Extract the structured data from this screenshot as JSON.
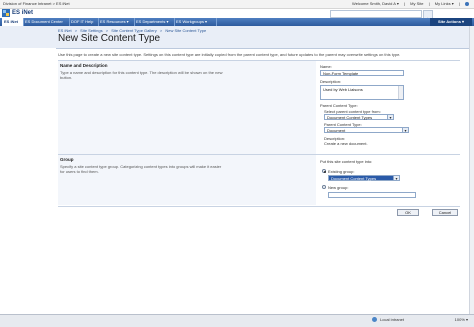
{
  "topbar": {
    "breadcrumb": "Division of Finance Intranet > ES iNet",
    "welcome": "Welcome Smith, David A ▾",
    "mysite": "My Site",
    "mylinks": "My Links ▾",
    "help_icon": "help-icon"
  },
  "site": {
    "title": "ES iNet",
    "logo_icon": "site-logo-icon",
    "search_icon": "search-icon"
  },
  "nav": {
    "tabs": [
      {
        "label": "ES iNet",
        "active": true
      },
      {
        "label": "ES Document Center"
      },
      {
        "label": "DOF IT Help"
      },
      {
        "label": "ES Resources ▾"
      },
      {
        "label": "ES Departments ▾"
      },
      {
        "label": "ES Workgroups ▾"
      }
    ],
    "site_actions": "Site Actions ▾"
  },
  "header": {
    "breadcrumb": [
      "ES iNet",
      "Site Settings",
      "Site Content Type Gallery",
      "New Site Content Type"
    ],
    "separator": ">",
    "page_title": "New Site Content Type"
  },
  "description": "Use this page to create a new site content type. Settings on this content type are initially copied from the parent content type, and future updates to the parent may overwrite settings on this type.",
  "section_name": {
    "heading": "Name and Description",
    "text": "Type a name and description for this content type. The description will be shown on the new button.",
    "name_label": "Name:",
    "name_value": "Non-Form Template",
    "description_label": "Description:",
    "description_value": "Used by Web Liaisons",
    "parent_label": "Parent Content Type:",
    "select_from_label": "Select parent content type from:",
    "select_from_value": "Document Content Types",
    "parent_type_label": "Parent Content Type:",
    "parent_type_value": "Document",
    "desc_label": "Description:",
    "desc_text": "Create a new document."
  },
  "section_group": {
    "heading": "Group",
    "text": "Specify a site content type group. Categorizing content types into groups will make it easier for users to find them.",
    "put_into_label": "Put this site content type into:",
    "existing_label": "Existing group:",
    "existing_value": "Document Content Types",
    "existing_selected": true,
    "new_label": "New group:",
    "new_value": ""
  },
  "buttons": {
    "ok": "OK",
    "cancel": "Cancel"
  },
  "statusbar": {
    "zone": "Local intranet",
    "zoom": "100% ▾"
  },
  "colors": {
    "nav_bg": "#2e5b9e",
    "header_bg": "#e9eef7",
    "accent": "#1a3f7a"
  }
}
